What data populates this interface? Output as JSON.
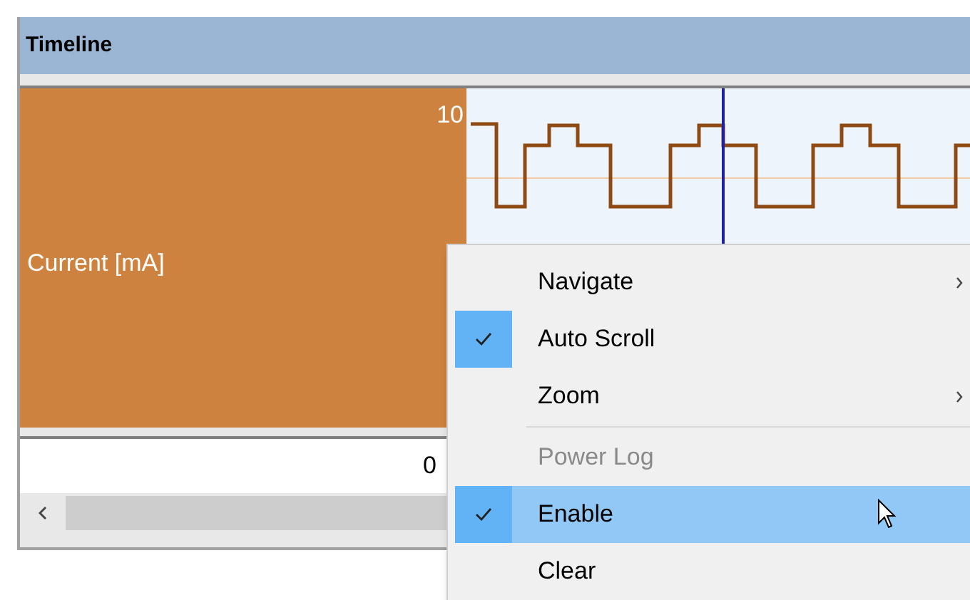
{
  "panel": {
    "title": "Timeline"
  },
  "channel": {
    "label": "Current [mA]",
    "axis_max": "10"
  },
  "x_axis": {
    "start": "0"
  },
  "context_menu": {
    "items": [
      {
        "kind": "item",
        "label": "Navigate",
        "checked": false,
        "selected": false,
        "submenu": true
      },
      {
        "kind": "item",
        "label": "Auto Scroll",
        "checked": true,
        "selected": false,
        "submenu": false
      },
      {
        "kind": "item",
        "label": "Zoom",
        "checked": false,
        "selected": false,
        "submenu": true
      },
      {
        "kind": "separator"
      },
      {
        "kind": "header",
        "label": "Power Log"
      },
      {
        "kind": "item",
        "label": "Enable",
        "checked": true,
        "selected": true,
        "submenu": false
      },
      {
        "kind": "item",
        "label": "Clear",
        "checked": false,
        "selected": false,
        "submenu": false
      }
    ]
  }
}
